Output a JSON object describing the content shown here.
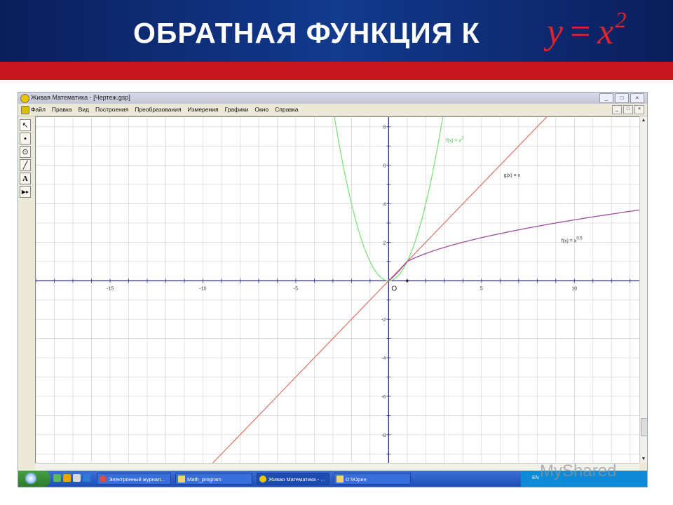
{
  "slide": {
    "title": "ОБРАТНАЯ ФУНКЦИЯ К",
    "formula_lhs": "y",
    "formula_eq": "=",
    "formula_base": "x",
    "formula_exp": "2"
  },
  "window": {
    "title": "Живая Математика - [Чертеж.gsp]",
    "buttons": [
      "_",
      "□",
      "×"
    ],
    "mdi_buttons": [
      "_",
      "□",
      "×"
    ]
  },
  "menu": [
    "Файл",
    "Правка",
    "Вид",
    "Построения",
    "Преобразования",
    "Измерения",
    "Графики",
    "Окно",
    "Справка"
  ],
  "toolbox": [
    {
      "name": "arrow-tool-icon",
      "glyph": "↖"
    },
    {
      "name": "point-tool-icon",
      "glyph": "•"
    },
    {
      "name": "compass-tool-icon",
      "glyph": "⊙"
    },
    {
      "name": "line-tool-icon",
      "glyph": "╱"
    },
    {
      "name": "text-tool-icon",
      "glyph": "A"
    },
    {
      "name": "custom-tool-icon",
      "glyph": "▶▸"
    }
  ],
  "graph": {
    "origin_label": "O",
    "x_range": [
      -19,
      13.5
    ],
    "y_range": [
      -9.5,
      8.5
    ],
    "x_tick_labels": [
      -15,
      -10,
      -5,
      5,
      10
    ],
    "y_tick_labels": [
      8,
      6,
      4,
      2,
      -2,
      -4,
      -6,
      -8
    ],
    "unit_point_x": 1,
    "series": [
      {
        "label": "f(x) = x",
        "sup": "2",
        "color": "#7ee37a",
        "label_pos": [
          3.1,
          7.2
        ]
      },
      {
        "label": "g(x) = x",
        "sup": "",
        "color": "#e07b6f",
        "label_pos": [
          6.2,
          5.4
        ]
      },
      {
        "label": "f(x) = x",
        "sup": "0.5",
        "color": "#9b4ea0",
        "label_pos": [
          9.3,
          2.0
        ]
      }
    ],
    "colors": {
      "axis": "#2b2b8f",
      "grid": "#d3d3d3"
    }
  },
  "taskbar": {
    "buttons": [
      "Электронный журнал...",
      "Math_program",
      "Живая Математика - ...",
      "D:\\Юрин"
    ],
    "tray_lang": "EN"
  },
  "watermark": "MyShared"
}
